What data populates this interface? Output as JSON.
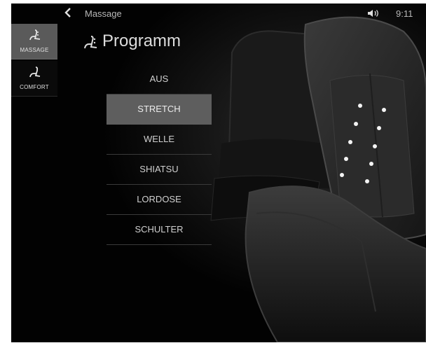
{
  "status_bar": {
    "title": "Massage",
    "time": "9:11"
  },
  "sidebar": {
    "items": [
      {
        "label": "MASSAGE",
        "icon": "massage-seat-icon",
        "active": true
      },
      {
        "label": "COMFORT",
        "icon": "seat-icon",
        "active": false
      }
    ]
  },
  "heading": {
    "icon": "massage-seat-icon",
    "title": "Programm"
  },
  "programs": {
    "selected": "STRETCH",
    "items": [
      "AUS",
      "STRETCH",
      "WELLE",
      "SHIATSU",
      "LORDOSE",
      "SCHULTER"
    ]
  },
  "colors": {
    "background": "#020202",
    "selected": "#5e5e5e",
    "text": "#d0d0d0"
  }
}
